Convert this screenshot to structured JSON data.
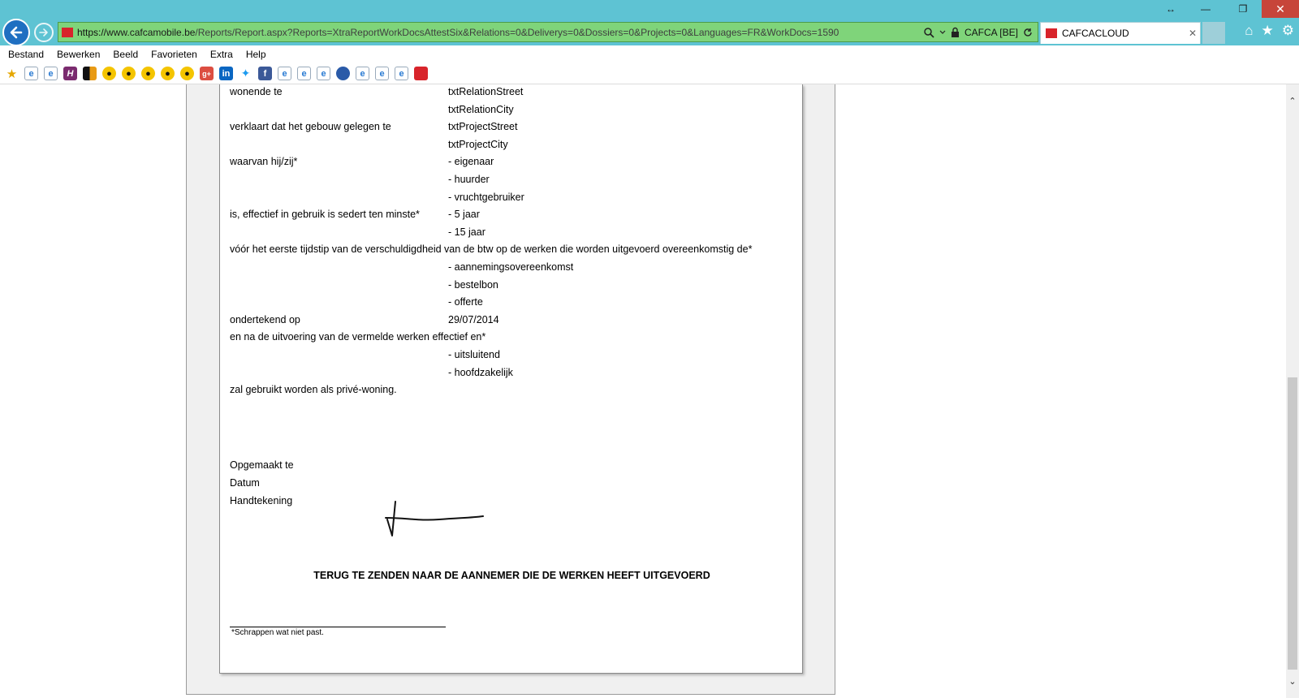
{
  "browser": {
    "window_controls": {
      "resize": "↔",
      "restore": "❐",
      "close": "✕"
    },
    "address": {
      "scheme": "https://",
      "host": "www.cafcamobile.be",
      "path": "/Reports/Report.aspx?Reports=XtraReportWorkDocsAttestSix&Relations=0&Deliverys=0&Dossiers=0&Projects=0&Languages=FR&WorkDocs=1590",
      "site_identity": "CAFCA [BE]"
    },
    "tab": {
      "title": "CAFCACLOUD",
      "close": "✕"
    },
    "menu": [
      "Bestand",
      "Bewerken",
      "Beeld",
      "Favorieten",
      "Extra",
      "Help"
    ]
  },
  "document": {
    "lines": [
      {
        "label": "wonende te",
        "value": "txtRelationStreet"
      },
      {
        "label": "",
        "value": "txtRelationCity"
      },
      {
        "label": "verklaart dat het gebouw gelegen te",
        "value": "txtProjectStreet"
      },
      {
        "label": "",
        "value": "txtProjectCity"
      },
      {
        "label": "waarvan hij/zij*",
        "value": "- eigenaar"
      },
      {
        "label": "",
        "value": "- huurder"
      },
      {
        "label": "",
        "value": "- vruchtgebruiker"
      },
      {
        "label": "is, effectief in gebruik is sedert ten minste*",
        "value": "- 5 jaar"
      },
      {
        "label": "",
        "value": "- 15 jaar"
      },
      {
        "label": "vóór het eerste tijdstip van de verschuldigdheid van de btw op de werken die worden uitgevoerd overeenkomstig de*",
        "value": ""
      },
      {
        "label": "",
        "value": "- aannemingsovereenkomst"
      },
      {
        "label": "",
        "value": "- bestelbon"
      },
      {
        "label": "",
        "value": "- offerte"
      },
      {
        "label": "ondertekend op",
        "value": "29/07/2014"
      },
      {
        "label": "en na de uitvoering van de vermelde werken effectief en*",
        "value": ""
      },
      {
        "label": "",
        "value": "- uitsluitend"
      },
      {
        "label": "",
        "value": "- hoofdzakelijk"
      },
      {
        "label": "zal gebruikt worden als privé-woning.",
        "value": ""
      }
    ],
    "opgemaakt_te": "Opgemaakt te",
    "datum": "Datum",
    "handtekening": "Handtekening",
    "footer_title": "TERUG TE ZENDEN NAAR DE AANNEMER DIE DE WERKEN HEEFT UITGEVOERD",
    "footnote": "*Schrappen wat niet past."
  }
}
